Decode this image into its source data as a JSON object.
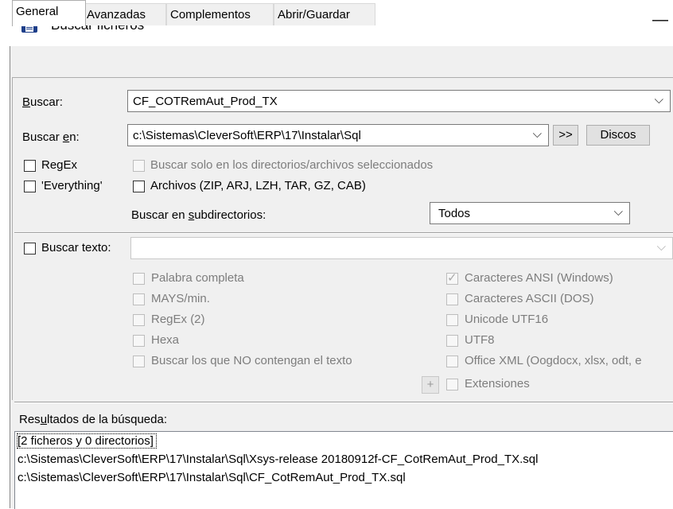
{
  "window": {
    "title": "Buscar ficheros",
    "minimize_glyph": "—"
  },
  "tabs": [
    {
      "label": "General"
    },
    {
      "label": "Avanzadas"
    },
    {
      "label": "Complementos"
    },
    {
      "label": "Abrir/Guardar"
    }
  ],
  "search": {
    "label_prefix": "B",
    "label_rest": "uscar:",
    "value": "CF_COTRemAut_Prod_TX"
  },
  "search_in": {
    "label_prefix": "Buscar ",
    "label_u": "e",
    "label_rest": "n:",
    "value": "c:\\Sistemas\\CleverSoft\\ERP\\17\\Instalar\\Sql",
    "next_button": ">>",
    "drives_button": "Discos"
  },
  "options": {
    "regex": "RegEx",
    "everything": "'Everything'",
    "only_selected": "Buscar solo en los directorios/archivos seleccionados",
    "archives": "Archivos (ZIP, ARJ, LZH, TAR, GZ, CAB)",
    "subdirs_label_prefix": "Buscar en ",
    "subdirs_label_u": "s",
    "subdirs_label_rest": "ubdirectorios:",
    "subdirs_value": "Todos"
  },
  "text_search": {
    "label": "Buscar texto:",
    "value": "",
    "left_options": [
      "Palabra completa",
      "MAYS/min.",
      "RegEx (2)",
      "Hexa",
      "Buscar los que NO contengan el texto"
    ],
    "right_options": [
      {
        "label": "Caracteres ANSI (Windows)",
        "checked": true
      },
      {
        "label": "Caracteres ASCII (DOS)",
        "checked": false
      },
      {
        "label": "Unicode UTF16",
        "checked": false
      },
      {
        "label": "UTF8",
        "checked": false
      },
      {
        "label": "Office XML (Oogdocx, xlsx, odt, e",
        "checked": false
      },
      {
        "label": "Extensiones",
        "checked": false
      }
    ],
    "plus": "+"
  },
  "results": {
    "label_prefix": "Res",
    "label_u": "u",
    "label_rest": "ltados de la búsqueda:",
    "rows": [
      "[2 ficheros y 0 directorios]",
      "c:\\Sistemas\\CleverSoft\\ERP\\17\\Instalar\\Sql\\Xsys-release 20180912f-CF_CotRemAut_Prod_TX.sql",
      "c:\\Sistemas\\CleverSoft\\ERP\\17\\Instalar\\Sql\\CF_CotRemAut_Prod_TX.sql"
    ]
  },
  "colors": {
    "window_bg": "#f0f0f0",
    "icon_accent": "#1e3f8a",
    "icon_red": "#c0392b"
  }
}
